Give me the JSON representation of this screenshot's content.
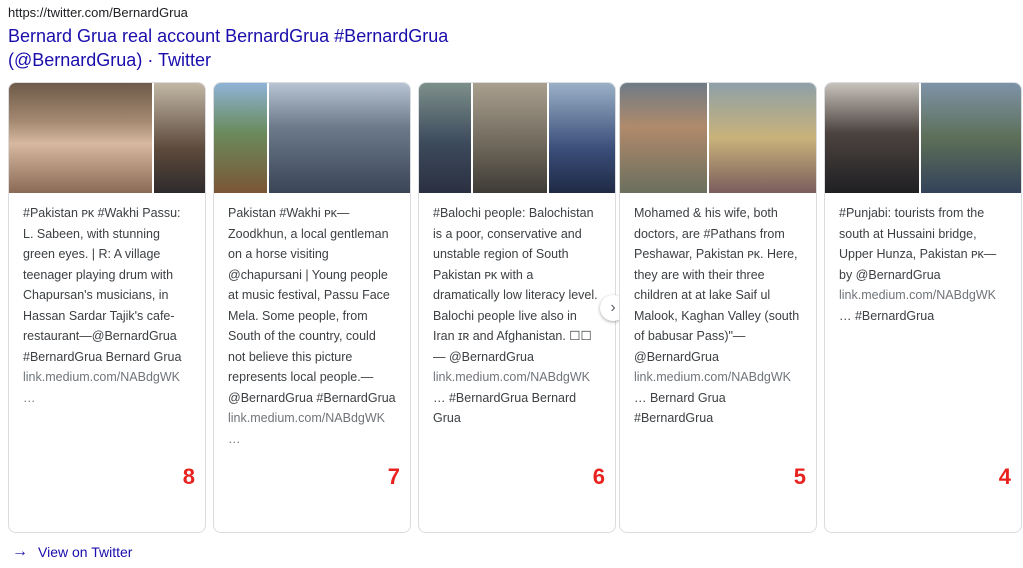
{
  "result": {
    "url": "https://twitter.com/BernardGrua",
    "title": "Bernard Grua real account BernardGrua #BernardGrua (@BernardGrua) · Twitter"
  },
  "cards": [
    {
      "text": "#Pakistan ᴘᴋ #Wakhi Passu: L. Sabeen, with stunning green eyes. | R: A village teenager playing drum with Chapursan's musicians, in Hassan Sardar Tajik's cafe-restaurant—@BernardGrua #BernardGrua Bernard Grua",
      "link": "link.medium.com/NABdgWK …",
      "number": "8"
    },
    {
      "text": "Pakistan #Wakhi ᴘᴋ— Zoodkhun, a local gentleman on a horse visiting @chapursani | Young people at music festival, Passu Face Mela. Some people, from South of the country, could not believe this picture represents local people.— @BernardGrua #BernardGrua",
      "link": "link.medium.com/NABdgWK …",
      "number": "7"
    },
    {
      "text": "#Balochi people: Balochistan is a poor, conservative and unstable region of South Pakistan ᴘᴋ with a dramatically low literacy level. Balochi people live also in Iran ɪʀ and Afghanistan. ☐☐— @BernardGrua",
      "link": "link.medium.com/NABdgWK",
      "tail": " … #BernardGrua Bernard Grua",
      "number": "6"
    },
    {
      "text": "Mohamed & his wife, both doctors, are #Pathans from Peshawar, Pakistan ᴘᴋ. Here, they are with their three children at at lake Saif ul Malook, Kaghan Valley (south of babusar Pass)\"— @BernardGrua",
      "link": "link.medium.com/NABdgWK",
      "tail": " … Bernard Grua #BernardGrua",
      "number": "5"
    },
    {
      "text": "#Punjabi: tourists from the south at Hussaini bridge, Upper Hunza, Pakistan ᴘᴋ— by @BernardGrua",
      "link": "link.medium.com/NABdgWK",
      "tail": " … #BernardGrua",
      "number": "4"
    }
  ],
  "footer": {
    "view_on": "View on Twitter"
  },
  "icons": {
    "next": "chevron-right-icon",
    "view_arrow": "arrow-right-icon"
  },
  "colors": {
    "link": "#1a0dab",
    "number": "#e8231f"
  }
}
